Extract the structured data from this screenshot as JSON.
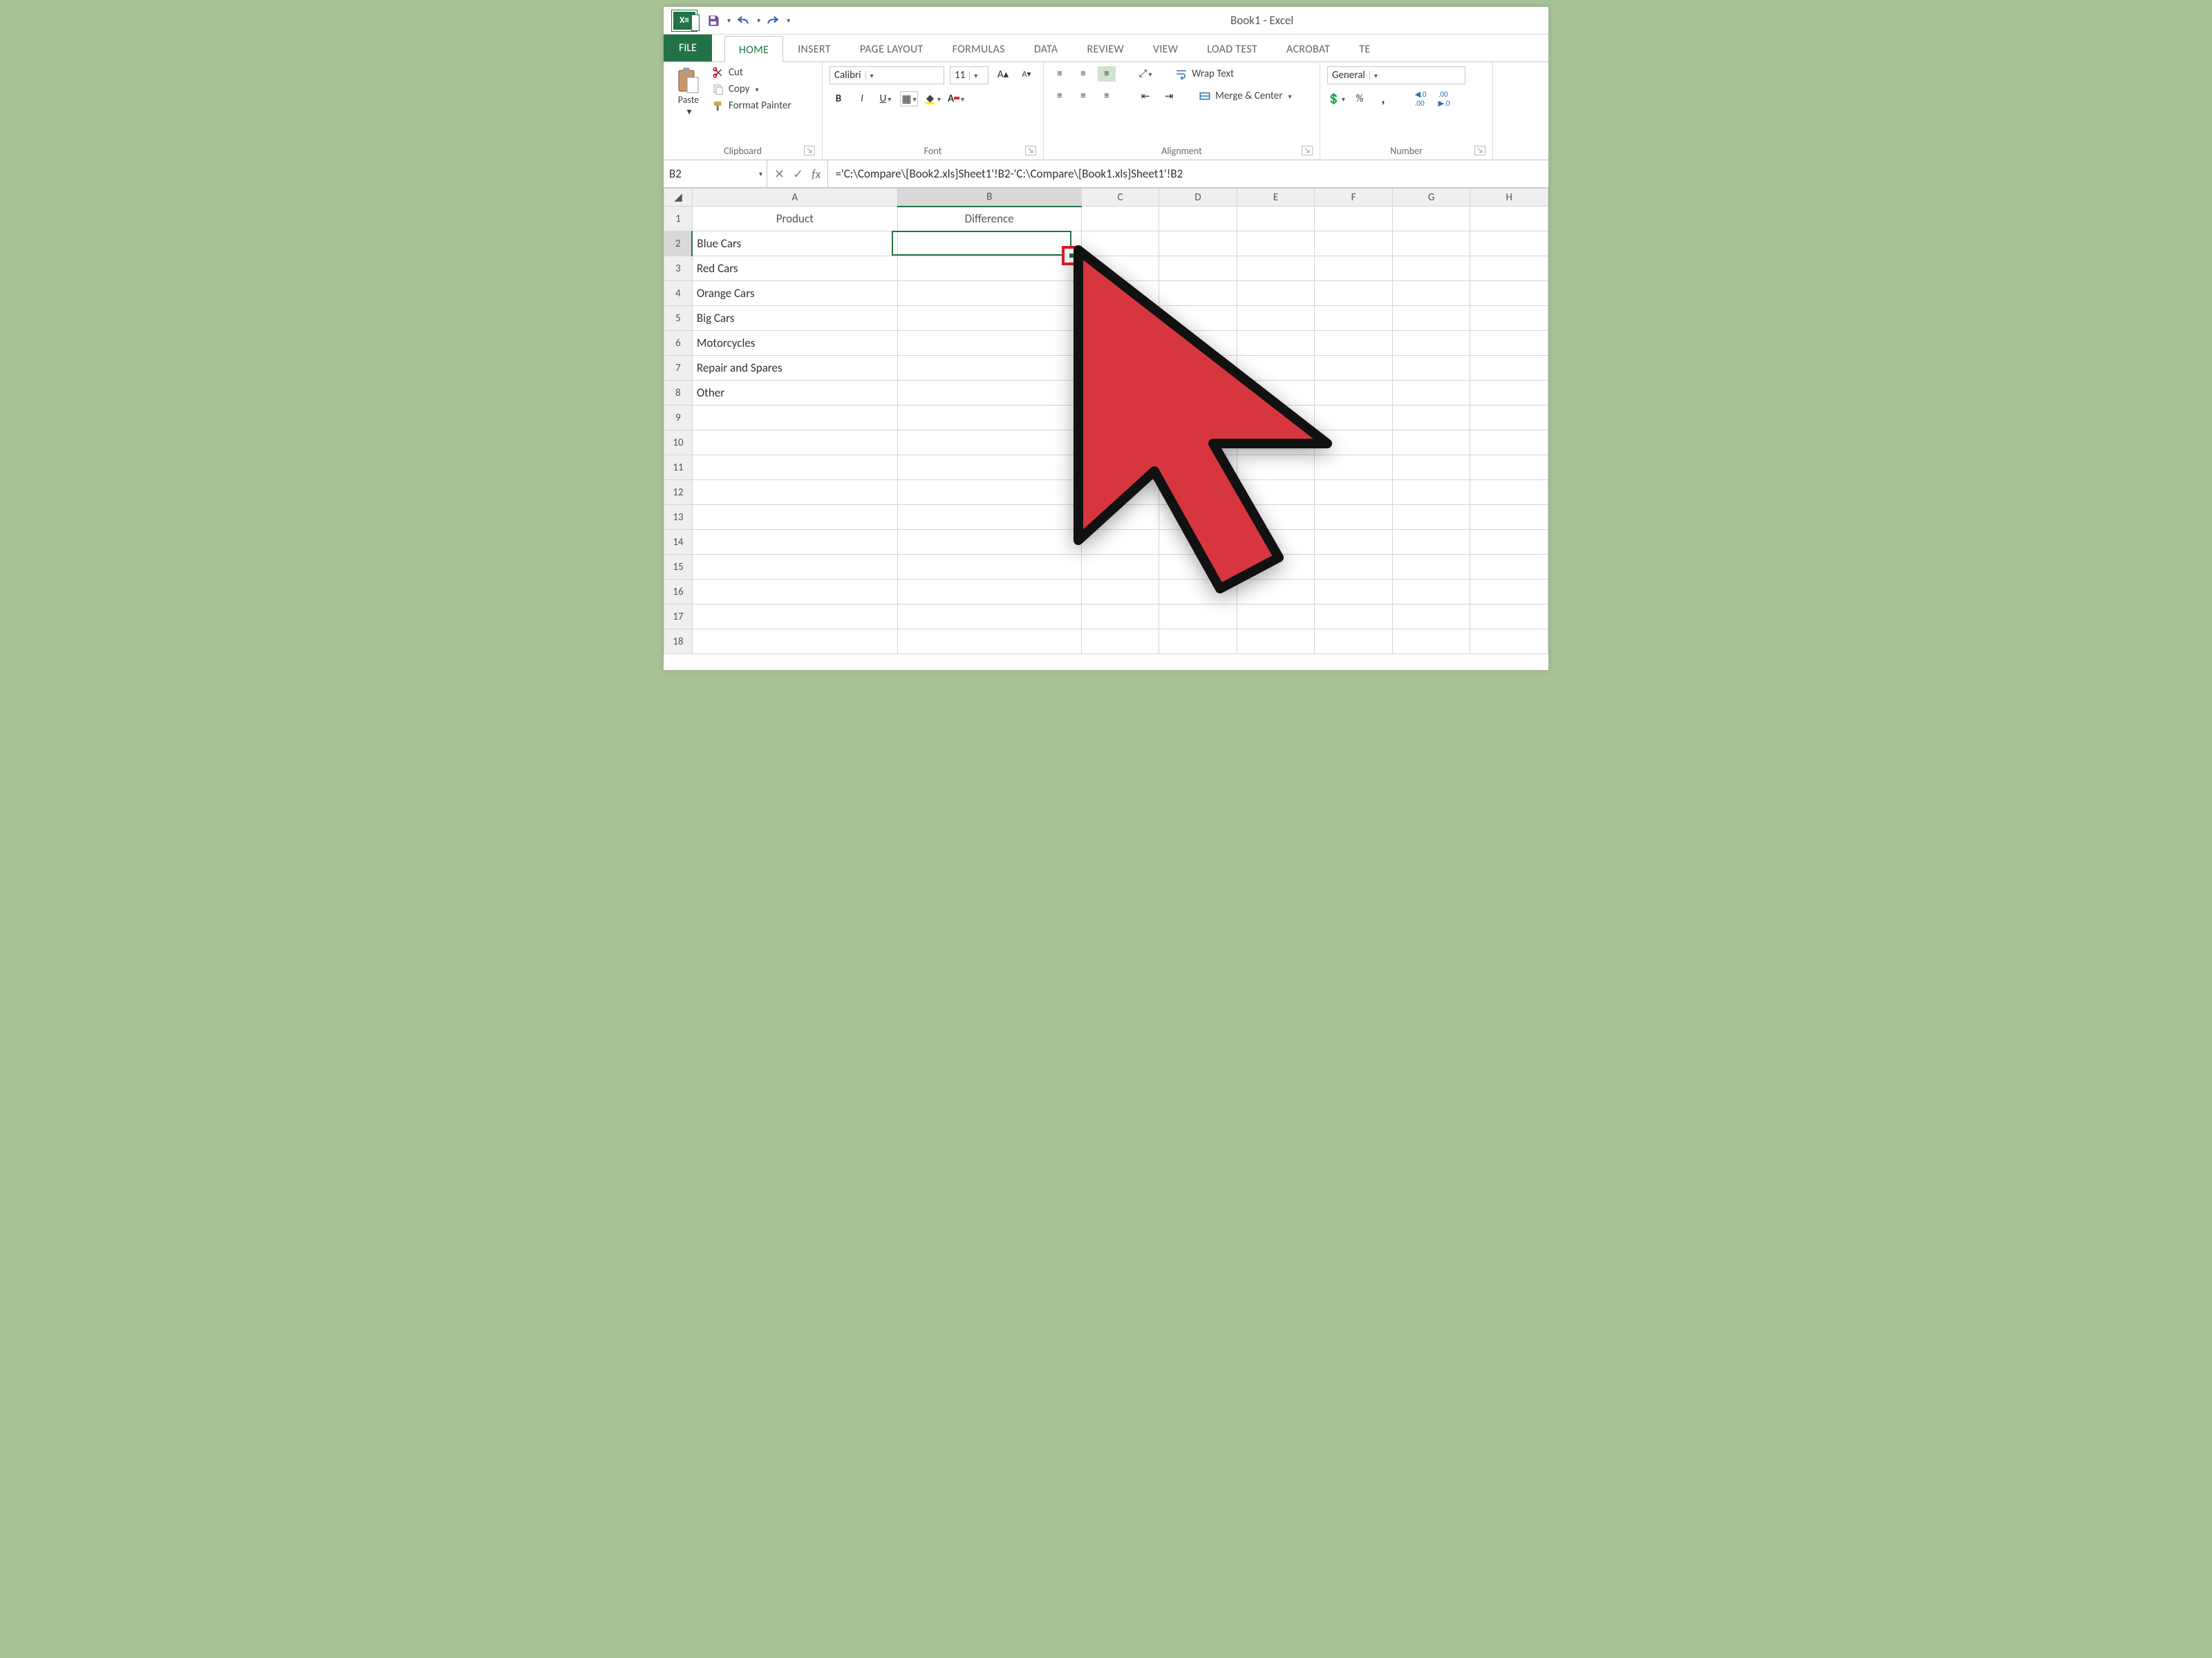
{
  "app": {
    "title": "Book1 - Excel"
  },
  "qat": {
    "save_tooltip": "Save",
    "undo_tooltip": "Undo",
    "redo_tooltip": "Redo"
  },
  "tabs": {
    "file": "FILE",
    "items": [
      "HOME",
      "INSERT",
      "PAGE LAYOUT",
      "FORMULAS",
      "DATA",
      "REVIEW",
      "VIEW",
      "LOAD TEST",
      "ACROBAT",
      "TE"
    ],
    "active_index": 0
  },
  "ribbon": {
    "clipboard": {
      "label": "Clipboard",
      "paste": "Paste",
      "cut": "Cut",
      "copy": "Copy",
      "format_painter": "Format Painter"
    },
    "font": {
      "label": "Font",
      "name": "Calibri",
      "size": "11",
      "bold": "B",
      "italic": "I",
      "underline": "U"
    },
    "alignment": {
      "label": "Alignment",
      "wrap": "Wrap Text",
      "merge": "Merge & Center"
    },
    "number": {
      "label": "Number",
      "format": "General",
      "percent": "%",
      "comma": ",",
      "inc": ".00→.0",
      "dec": ".0→.00"
    }
  },
  "formula_bar": {
    "name_box": "B2",
    "cancel": "✕",
    "enter": "✓",
    "fx": "fx",
    "formula": "='C:\\Compare\\[Book2.xls]Sheet1'!B2-'C:\\Compare\\[Book1.xls]Sheet1'!B2"
  },
  "grid": {
    "col_headers": [
      "A",
      "B",
      "C",
      "D",
      "E",
      "F",
      "G",
      "H"
    ],
    "selected_col_index": 1,
    "selected_row": 2,
    "row_headers": [
      1,
      2,
      3,
      4,
      5,
      6,
      7,
      8,
      9,
      10,
      11,
      12,
      13,
      14,
      15,
      16,
      17,
      18
    ],
    "rows": [
      {
        "A": "Product",
        "B": "Difference",
        "a_class": "header-cell",
        "b_class": "header-cell"
      },
      {
        "A": "Blue Cars",
        "B": ""
      },
      {
        "A": "Red Cars",
        "B": ""
      },
      {
        "A": "Orange Cars",
        "B": ""
      },
      {
        "A": "Big Cars",
        "B": ""
      },
      {
        "A": "Motorcycles",
        "B": ""
      },
      {
        "A": "Repair and Spares",
        "B": ""
      },
      {
        "A": "Other",
        "B": ""
      },
      {
        "A": "",
        "B": ""
      },
      {
        "A": "",
        "B": ""
      },
      {
        "A": "",
        "B": ""
      },
      {
        "A": "",
        "B": ""
      },
      {
        "A": "",
        "B": ""
      },
      {
        "A": "",
        "B": ""
      },
      {
        "A": "",
        "B": ""
      },
      {
        "A": "",
        "B": ""
      },
      {
        "A": "",
        "B": ""
      },
      {
        "A": "",
        "B": ""
      }
    ]
  },
  "annotation": {
    "fill_handle_highlight": "fill-handle of B2",
    "cursor": "large red arrow pointer"
  }
}
